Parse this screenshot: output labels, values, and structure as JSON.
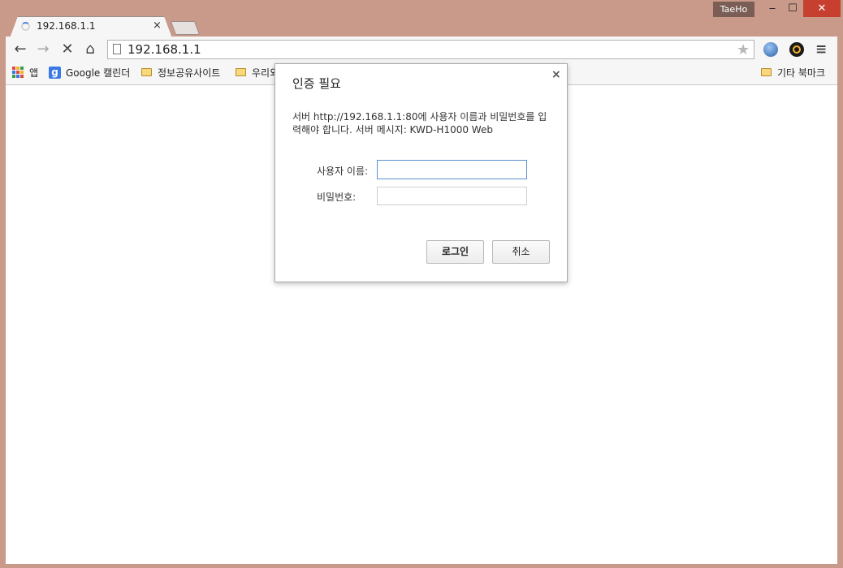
{
  "window": {
    "profile_name": "TaeHo",
    "minimize_glyph": "‒",
    "maximize_glyph": "☐",
    "close_glyph": "✕"
  },
  "tab": {
    "title": "192.168.1.1",
    "close_glyph": "×"
  },
  "toolbar": {
    "back_glyph": "←",
    "forward_glyph": "→",
    "stop_glyph": "✕",
    "home_glyph": "⌂",
    "address": "192.168.1.1",
    "star_glyph": "★",
    "menu_glyph": "≡"
  },
  "bookmarks": {
    "apps_label": "앱",
    "items": [
      {
        "label": "Google 캘린더",
        "icon": "google-icon"
      },
      {
        "label": "정보공유사이트",
        "icon": "folder-icon"
      },
      {
        "label": "우리외",
        "icon": "folder-icon"
      }
    ],
    "other_label": "기타 북마크"
  },
  "dialog": {
    "title": "인증 필요",
    "close_glyph": "×",
    "message": "서버 http://192.168.1.1:80에 사용자 이름과 비밀번호를 입력해야 합니다. 서버 메시지: KWD-H1000 Web",
    "username_label": "사용자 이름:",
    "username_value": "",
    "password_label": "비밀번호:",
    "password_value": "",
    "login_label": "로그인",
    "cancel_label": "취소"
  },
  "colors": {
    "frame": "#c9998a",
    "close_button": "#c7402f",
    "focus_border": "#5a8fd0"
  }
}
